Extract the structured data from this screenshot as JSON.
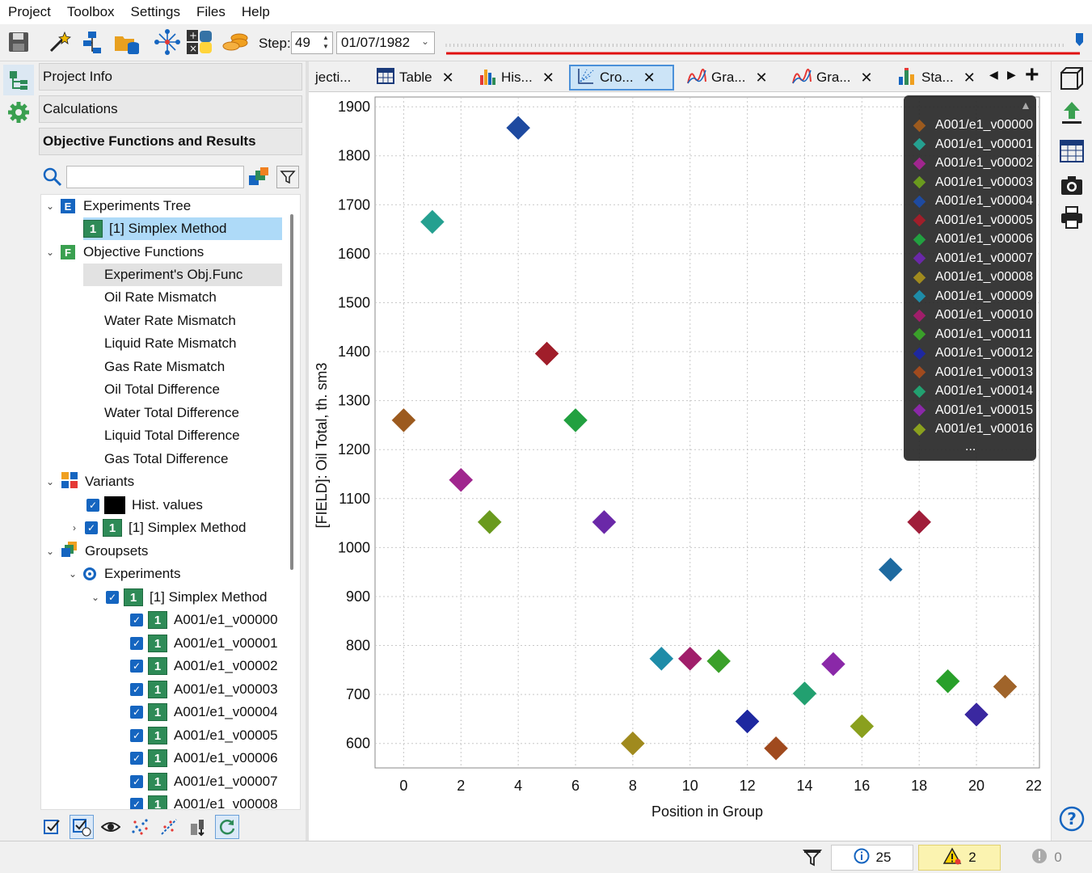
{
  "menu": [
    "Project",
    "Toolbox",
    "Settings",
    "Files",
    "Help"
  ],
  "toolbar": {
    "step_label": "Step:",
    "step_value": "49",
    "date_value": "01/07/1982",
    "timeline_color": "#e01010",
    "timeline_marker_color": "#1565c0"
  },
  "left_panel": {
    "project_info": "Project Info",
    "calculations": "Calculations",
    "objective_header": "Objective Functions and Results",
    "search_value": ""
  },
  "tree": {
    "experiments_tree": "Experiments Tree",
    "simplex_selected": "[1] Simplex Method",
    "objective_functions": "Objective Functions",
    "obj_items": [
      "Experiment's Obj.Func",
      "Oil Rate Mismatch",
      "Water Rate Mismatch",
      "Liquid Rate Mismatch",
      "Gas Rate Mismatch",
      "Oil Total Difference",
      "Water Total Difference",
      "Liquid Total Difference",
      "Gas Total Difference"
    ],
    "variants": "Variants",
    "hist_values": "Hist. values",
    "simplex_variant": "[1] Simplex Method",
    "groupsets": "Groupsets",
    "experiments": "Experiments",
    "simplex_group": "[1] Simplex Method",
    "badge": "1",
    "variant_items": [
      "A001/e1_v00000",
      "A001/e1_v00001",
      "A001/e1_v00002",
      "A001/e1_v00003",
      "A001/e1_v00004",
      "A001/e1_v00005",
      "A001/e1_v00006",
      "A001/e1_v00007",
      "A001/e1_v00008"
    ]
  },
  "tabs": [
    {
      "label": "jecti...",
      "close": false
    },
    {
      "label": "Table",
      "close": true
    },
    {
      "label": "His...",
      "close": true
    },
    {
      "label": "Cro...",
      "close": true,
      "active": true
    },
    {
      "label": "Gra...",
      "close": true
    },
    {
      "label": "Gra...",
      "close": true
    },
    {
      "label": "Sta...",
      "close": true
    }
  ],
  "status": {
    "info_count": "25",
    "warning_count": "2",
    "error_count": "0"
  },
  "chart_data": {
    "type": "scatter",
    "xlabel": "Position in Group",
    "ylabel": "[FIELD]: Oil Total, th. sm3",
    "xlim": [
      -1,
      22.2
    ],
    "ylim": [
      550,
      1920
    ],
    "xticks": [
      0,
      2,
      4,
      6,
      8,
      10,
      12,
      14,
      16,
      18,
      20,
      22
    ],
    "yticks": [
      600,
      700,
      800,
      900,
      1000,
      1100,
      1200,
      1300,
      1400,
      1500,
      1600,
      1700,
      1800,
      1900
    ],
    "grid": true,
    "legend_position": "top-right",
    "legend_more": "...",
    "points": [
      {
        "name": "A001/e1_v00000",
        "x": 0,
        "y": 1260,
        "color": "#9c5a1e"
      },
      {
        "name": "A001/e1_v00001",
        "x": 1,
        "y": 1665,
        "color": "#25a090"
      },
      {
        "name": "A001/e1_v00002",
        "x": 2,
        "y": 1138,
        "color": "#a0268e"
      },
      {
        "name": "A001/e1_v00003",
        "x": 3,
        "y": 1052,
        "color": "#6a9a1e"
      },
      {
        "name": "A001/e1_v00004",
        "x": 4,
        "y": 1857,
        "color": "#1e4aa0"
      },
      {
        "name": "A001/e1_v00005",
        "x": 5,
        "y": 1396,
        "color": "#a01e2a"
      },
      {
        "name": "A001/e1_v00006",
        "x": 6,
        "y": 1260,
        "color": "#22a040"
      },
      {
        "name": "A001/e1_v00007",
        "x": 7,
        "y": 1052,
        "color": "#6a28a8"
      },
      {
        "name": "A001/e1_v00008",
        "x": 8,
        "y": 600,
        "color": "#a08a1e"
      },
      {
        "name": "A001/e1_v00009",
        "x": 9,
        "y": 773,
        "color": "#1e8ca8"
      },
      {
        "name": "A001/e1_v00010",
        "x": 10,
        "y": 773,
        "color": "#a01e6a"
      },
      {
        "name": "A001/e1_v00011",
        "x": 11,
        "y": 768,
        "color": "#3aa02a"
      },
      {
        "name": "A001/e1_v00012",
        "x": 12,
        "y": 645,
        "color": "#1e28a0"
      },
      {
        "name": "A001/e1_v00013",
        "x": 13,
        "y": 590,
        "color": "#a04a1e"
      },
      {
        "name": "A001/e1_v00014",
        "x": 14,
        "y": 702,
        "color": "#22a070"
      },
      {
        "name": "A001/e1_v00015",
        "x": 15,
        "y": 762,
        "color": "#8a28a8"
      },
      {
        "name": "A001/e1_v00016",
        "x": 16,
        "y": 635,
        "color": "#8aa01e"
      },
      {
        "name": "",
        "x": 17,
        "y": 955,
        "color": "#1e6aa0"
      },
      {
        "name": "",
        "x": 18,
        "y": 1052,
        "color": "#a01e3a"
      },
      {
        "name": "",
        "x": 19,
        "y": 727,
        "color": "#28a02a"
      },
      {
        "name": "",
        "x": 20,
        "y": 659,
        "color": "#3a28a0"
      },
      {
        "name": "",
        "x": 21,
        "y": 716,
        "color": "#a0642a"
      }
    ]
  }
}
